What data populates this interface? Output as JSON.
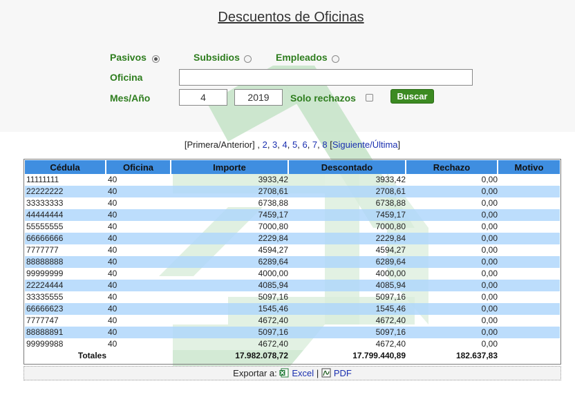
{
  "page": {
    "title": "Descuentos de Oficinas"
  },
  "form": {
    "type_options": [
      {
        "label": "Pasivos",
        "checked": true
      },
      {
        "label": "Subsidios",
        "checked": false
      },
      {
        "label": "Empleados",
        "checked": false
      }
    ],
    "oficina_label": "Oficina",
    "oficina_value": "",
    "mes_anio_label": "Mes/Año",
    "mes_value": "4",
    "anio_value": "2019",
    "solo_rechazos_label": "Solo rechazos",
    "solo_rechazos_checked": false,
    "search_button": "Buscar"
  },
  "pager": {
    "first_prev": "[Primera/Anterior]",
    "comma": ",",
    "pages": [
      "2",
      "3",
      "4",
      "5",
      "6",
      "7",
      "8"
    ],
    "bracket_open": "[",
    "next_last": "Siguiente/Última",
    "bracket_close": "]"
  },
  "table": {
    "columns": [
      "Cédula",
      "Oficina",
      "Importe",
      "Descontado",
      "Rechazo",
      "Motivo"
    ],
    "rows": [
      {
        "cedula": "11111111",
        "oficina": "40",
        "importe": "3933,42",
        "descontado": "3933,42",
        "rechazo": "0,00",
        "motivo": ""
      },
      {
        "cedula": "22222222",
        "oficina": "40",
        "importe": "2708,61",
        "descontado": "2708,61",
        "rechazo": "0,00",
        "motivo": ""
      },
      {
        "cedula": "33333333",
        "oficina": "40",
        "importe": "6738,88",
        "descontado": "6738,88",
        "rechazo": "0,00",
        "motivo": ""
      },
      {
        "cedula": "44444444",
        "oficina": "40",
        "importe": "7459,17",
        "descontado": "7459,17",
        "rechazo": "0,00",
        "motivo": ""
      },
      {
        "cedula": "55555555",
        "oficina": "40",
        "importe": "7000,80",
        "descontado": "7000,80",
        "rechazo": "0,00",
        "motivo": ""
      },
      {
        "cedula": "66666666",
        "oficina": "40",
        "importe": "2229,84",
        "descontado": "2229,84",
        "rechazo": "0,00",
        "motivo": ""
      },
      {
        "cedula": "7777777",
        "oficina": "40",
        "importe": "4594,27",
        "descontado": "4594,27",
        "rechazo": "0,00",
        "motivo": ""
      },
      {
        "cedula": "88888888",
        "oficina": "40",
        "importe": "6289,64",
        "descontado": "6289,64",
        "rechazo": "0,00",
        "motivo": ""
      },
      {
        "cedula": "99999999",
        "oficina": "40",
        "importe": "4000,00",
        "descontado": "4000,00",
        "rechazo": "0,00",
        "motivo": ""
      },
      {
        "cedula": "22224444",
        "oficina": "40",
        "importe": "4085,94",
        "descontado": "4085,94",
        "rechazo": "0,00",
        "motivo": ""
      },
      {
        "cedula": "33335555",
        "oficina": "40",
        "importe": "5097,16",
        "descontado": "5097,16",
        "rechazo": "0,00",
        "motivo": ""
      },
      {
        "cedula": "66666623",
        "oficina": "40",
        "importe": "1545,46",
        "descontado": "1545,46",
        "rechazo": "0,00",
        "motivo": ""
      },
      {
        "cedula": "7777747",
        "oficina": "40",
        "importe": "4672,40",
        "descontado": "4672,40",
        "rechazo": "0,00",
        "motivo": ""
      },
      {
        "cedula": "88888891",
        "oficina": "40",
        "importe": "5097,16",
        "descontado": "5097,16",
        "rechazo": "0,00",
        "motivo": ""
      },
      {
        "cedula": "99999988",
        "oficina": "40",
        "importe": "4672,40",
        "descontado": "4672,40",
        "rechazo": "0,00",
        "motivo": ""
      }
    ],
    "totals": {
      "label": "Totales",
      "importe": "17.982.078,72",
      "descontado": "17.799.440,89",
      "rechazo": "182.637,83"
    }
  },
  "export": {
    "label": "Exportar a:",
    "excel": "Excel",
    "separator": "|",
    "pdf": "PDF",
    "excel_icon": "excel-icon",
    "pdf_icon": "pdf-icon"
  },
  "colors": {
    "label_green": "#2e7d1e",
    "button_green": "#3c8a22",
    "header_blue": "#3f8ee0",
    "row_alt_blue": "#b3d8fc",
    "watermark_green": "#c4e3c7",
    "link_blue": "#1a2fb0"
  }
}
